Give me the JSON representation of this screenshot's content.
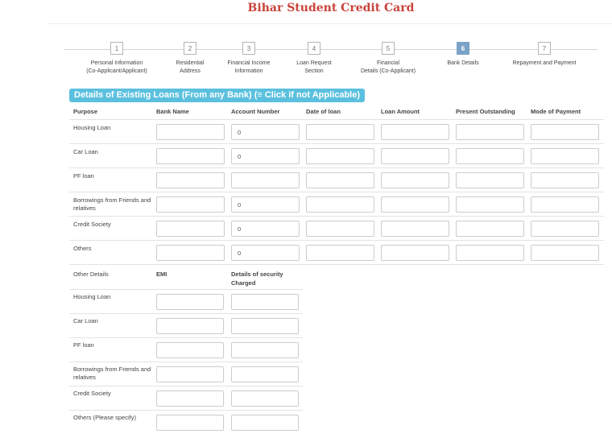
{
  "page": {
    "title": "Bihar Student Credit Card"
  },
  "steps": [
    {
      "num": "1",
      "label": "Personal Information\n(Co-Applicant/Applicant)",
      "active": false
    },
    {
      "num": "2",
      "label": "Residential\nAddress",
      "active": false
    },
    {
      "num": "3",
      "label": "Financial Income\nInformation",
      "active": false
    },
    {
      "num": "4",
      "label": "Loan Request\nSection",
      "active": false
    },
    {
      "num": "5",
      "label": "Financial\nDetails (Co-Applicant)",
      "active": false
    },
    {
      "num": "6",
      "label": "Bank Details",
      "active": true
    },
    {
      "num": "7",
      "label": "Repayment and Payment",
      "active": false
    }
  ],
  "existing_loans": {
    "banner": "Details of Existing Loans (From any Bank)  (≡ Click if not Applicable)",
    "headers": [
      "Purpose",
      "Bank Name",
      "Account Number",
      "Date of loan",
      "Loan Amount",
      "Present Outstanding",
      "Mode of Payment"
    ],
    "rows": [
      {
        "purpose": "Housing Loan",
        "bank_name": "",
        "account_number": "0",
        "date_of_loan": "",
        "loan_amount": "",
        "present_outstanding": "",
        "mode_of_payment": ""
      },
      {
        "purpose": "Car Loan",
        "bank_name": "",
        "account_number": "0",
        "date_of_loan": "",
        "loan_amount": "",
        "present_outstanding": "",
        "mode_of_payment": ""
      },
      {
        "purpose": "PF loan",
        "bank_name": "",
        "account_number": "",
        "date_of_loan": "",
        "loan_amount": "",
        "present_outstanding": "",
        "mode_of_payment": ""
      },
      {
        "purpose": "Borrowings from Friends and relatives",
        "bank_name": "",
        "account_number": "0",
        "date_of_loan": "",
        "loan_amount": "",
        "present_outstanding": "",
        "mode_of_payment": ""
      },
      {
        "purpose": "Credit Society",
        "bank_name": "",
        "account_number": "0",
        "date_of_loan": "",
        "loan_amount": "",
        "present_outstanding": "",
        "mode_of_payment": ""
      },
      {
        "purpose": "Others",
        "bank_name": "",
        "account_number": "0",
        "date_of_loan": "",
        "loan_amount": "",
        "present_outstanding": "",
        "mode_of_payment": ""
      }
    ]
  },
  "other_details": {
    "headers": [
      "Other Details",
      "EMI",
      "Details of security Charged"
    ],
    "rows": [
      {
        "label": "Housing Loan",
        "emi": "",
        "security": ""
      },
      {
        "label": "Car Loan",
        "emi": "",
        "security": ""
      },
      {
        "label": "PF loan",
        "emi": "",
        "security": ""
      },
      {
        "label": "Borrowings from Friends and relatives",
        "emi": "",
        "security": ""
      },
      {
        "label": "Credit Society",
        "emi": "",
        "security": ""
      },
      {
        "label": "Others (Please specify)",
        "emi": "",
        "security": ""
      }
    ]
  }
}
